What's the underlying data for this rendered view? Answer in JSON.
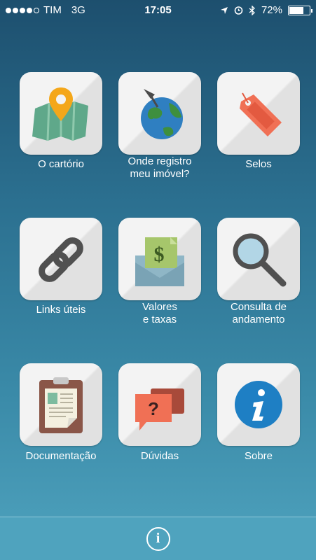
{
  "status_bar": {
    "carrier": "TIM",
    "network": "3G",
    "time": "17:05",
    "battery": "72%",
    "battery_level": 0.72
  },
  "menu": [
    {
      "label": "O cartório",
      "icon": "map-pin-icon"
    },
    {
      "label": "Onde registro\nmeu imóvel?",
      "icon": "globe-pin-icon"
    },
    {
      "label": "Selos",
      "icon": "price-tag-icon"
    },
    {
      "label": "Links úteis",
      "icon": "chain-link-icon"
    },
    {
      "label": "Valores\ne taxas",
      "icon": "money-envelope-icon"
    },
    {
      "label": "Consulta de\nandamento",
      "icon": "magnifier-icon"
    },
    {
      "label": "Documentação",
      "icon": "clipboard-icon"
    },
    {
      "label": "Dúvidas",
      "icon": "question-bubble-icon"
    },
    {
      "label": "Sobre",
      "icon": "info-circle-icon"
    }
  ],
  "bottom_bar": {
    "info_label": "i"
  }
}
